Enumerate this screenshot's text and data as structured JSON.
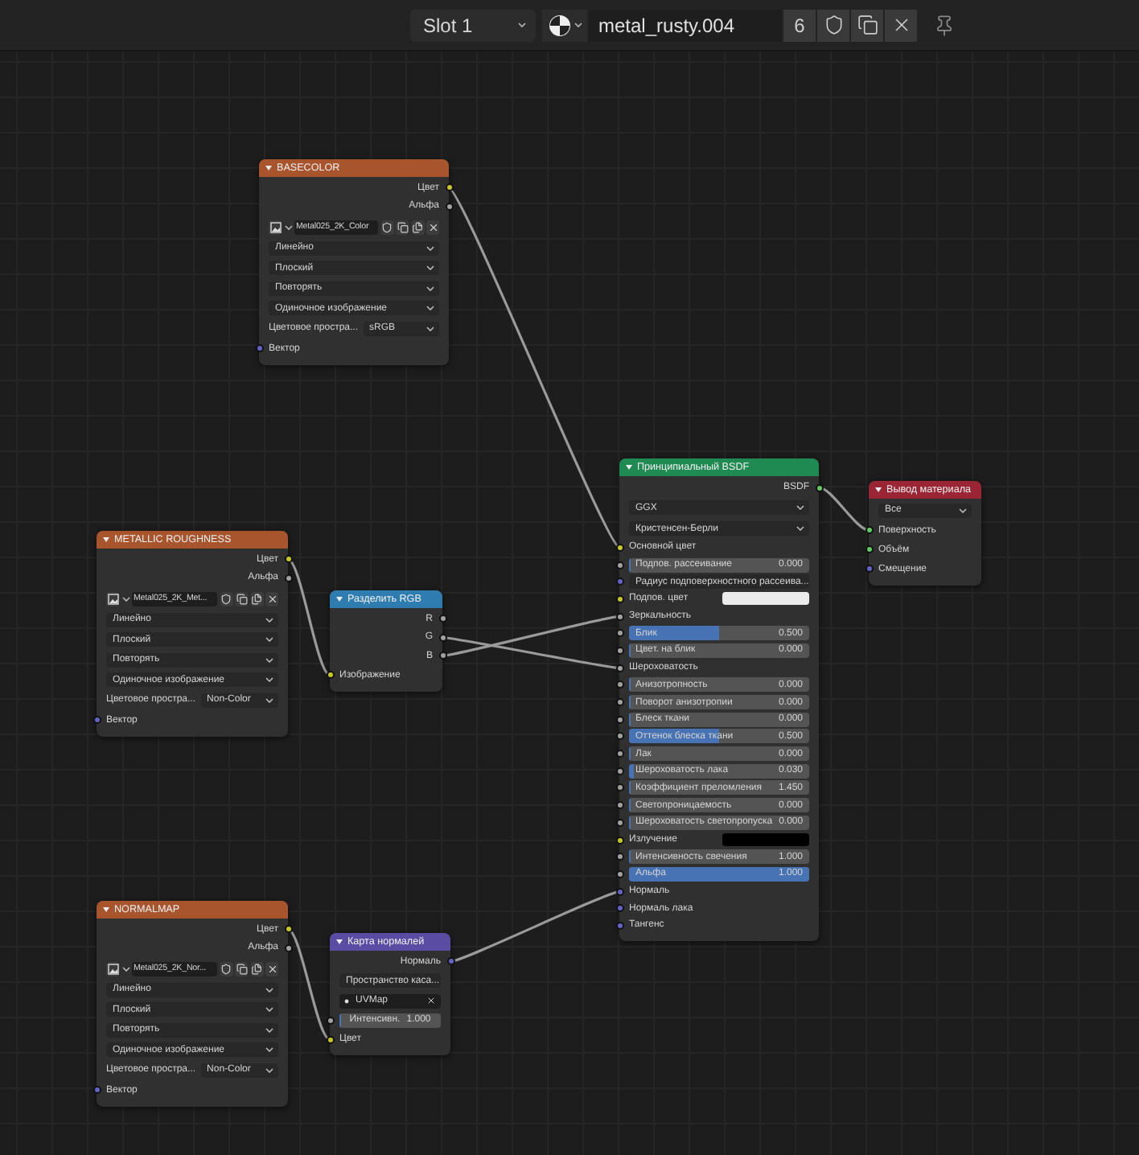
{
  "toolbar": {
    "slot": "Slot 1",
    "material_name": "metal_rusty.004",
    "users": "6"
  },
  "nodes": [
    {
      "kind": "image_texture",
      "title": "BASECOLOR",
      "color": "#a8552e",
      "rows": [
        {
          "kind": "output",
          "label": "Цвет",
          "color": "#c7c729"
        },
        {
          "kind": "output",
          "label": "Альфа",
          "color": "#a1a1a1"
        },
        {
          "kind": "image",
          "value": "Metal025_2K_Color"
        },
        {
          "kind": "dropdown",
          "value": "Линейно"
        },
        {
          "kind": "dropdown",
          "value": "Плоский"
        },
        {
          "kind": "dropdown",
          "value": "Повторять"
        },
        {
          "kind": "dropdown",
          "value": "Одиночное изображение"
        },
        {
          "kind": "prop",
          "label": "Цветовое простра...",
          "value": "sRGB"
        },
        {
          "kind": "input",
          "label": "Вектор",
          "color": "#6363c7"
        }
      ]
    },
    {
      "kind": "principled",
      "title": "Принципиальный BSDF",
      "color": "#1f8a52",
      "rows": [
        {
          "kind": "output",
          "label": "BSDF",
          "color": "#63c763"
        },
        {
          "kind": "dropdown",
          "value": "GGX"
        },
        {
          "kind": "dropdown",
          "value": "Кристенсен-Берли"
        },
        {
          "kind": "input",
          "label": "Основной цвет",
          "color": "#c7c729"
        },
        {
          "kind": "value",
          "label": "Подпов. рассеивание",
          "value": "0.000",
          "level": 0,
          "color": "#a1a1a1"
        },
        {
          "kind": "socket_menu",
          "value": "Радиус подповерхностного рассеива...",
          "color": "#6363c7"
        },
        {
          "kind": "color",
          "label": "Подпов. цвет",
          "swatch": {
            "color": "#ececec"
          },
          "color": "#c7c729"
        },
        {
          "kind": "input",
          "label": "Зеркальность",
          "color": "#a1a1a1"
        },
        {
          "kind": "value",
          "label": "Блик",
          "value": "0.500",
          "level": 0.5,
          "color": "#a1a1a1"
        },
        {
          "kind": "value",
          "label": "Цвет. на блик",
          "value": "0.000",
          "level": 0,
          "color": "#a1a1a1"
        },
        {
          "kind": "input",
          "label": "Шероховатость",
          "color": "#a1a1a1"
        },
        {
          "kind": "value",
          "label": "Анизотропность",
          "value": "0.000",
          "level": 0,
          "color": "#a1a1a1"
        },
        {
          "kind": "value",
          "label": "Поворот анизотропии",
          "value": "0.000",
          "level": 0,
          "color": "#a1a1a1"
        },
        {
          "kind": "value",
          "label": "Блеск ткани",
          "value": "0.000",
          "level": 0,
          "color": "#a1a1a1"
        },
        {
          "kind": "value",
          "label": "Оттенок блеска ткани",
          "value": "0.500",
          "level": 0.5,
          "color": "#a1a1a1"
        },
        {
          "kind": "value",
          "label": "Лак",
          "value": "0.000",
          "level": 0,
          "color": "#a1a1a1"
        },
        {
          "kind": "value",
          "label": "Шероховатость лака",
          "value": "0.030",
          "level": 0.03,
          "color": "#a1a1a1"
        },
        {
          "kind": "value",
          "label": "Коэффициент преломления",
          "value": "1.450",
          "level": 0,
          "color": "#a1a1a1"
        },
        {
          "kind": "value",
          "label": "Светопроницаемость",
          "value": "0.000",
          "level": 0,
          "color": "#a1a1a1"
        },
        {
          "kind": "value",
          "label": "Шероховатость светопропуска",
          "value": "0.000",
          "level": 0,
          "color": "#a1a1a1"
        },
        {
          "kind": "color",
          "label": "Излучение",
          "swatch": {
            "color": "#000000"
          },
          "color": "#c7c729"
        },
        {
          "kind": "value",
          "label": "Интенсивность свечения",
          "value": "1.000",
          "level": 0,
          "color": "#a1a1a1"
        },
        {
          "kind": "value",
          "label": "Альфа",
          "value": "1.000",
          "level": 1,
          "color": "#a1a1a1"
        },
        {
          "kind": "input",
          "label": "Нормаль",
          "color": "#6363c7"
        },
        {
          "kind": "input",
          "label": "Нормаль лака",
          "color": "#6363c7"
        },
        {
          "kind": "input",
          "label": "Тангенс",
          "color": "#6363c7"
        }
      ]
    },
    {
      "kind": "output_node",
      "title": "Вывод материала",
      "color": "#9a2535",
      "rows": [
        {
          "kind": "dropdown",
          "value": "Все"
        },
        {
          "kind": "input",
          "label": "Поверхность",
          "color": "#63c763"
        },
        {
          "kind": "input",
          "label": "Объём",
          "color": "#63c763"
        },
        {
          "kind": "input",
          "label": "Смещение",
          "color": "#6363c7"
        }
      ]
    },
    {
      "kind": "image_texture",
      "title": "METALLIC ROUGHNESS",
      "color": "#a8552e",
      "rows": [
        {
          "kind": "output",
          "label": "Цвет",
          "color": "#c7c729"
        },
        {
          "kind": "output",
          "label": "Альфа",
          "color": "#a1a1a1"
        },
        {
          "kind": "image",
          "value": "Metal025_2K_Met..."
        },
        {
          "kind": "dropdown",
          "value": "Линейно"
        },
        {
          "kind": "dropdown",
          "value": "Плоский"
        },
        {
          "kind": "dropdown",
          "value": "Повторять"
        },
        {
          "kind": "dropdown",
          "value": "Одиночное изображение"
        },
        {
          "kind": "prop",
          "label": "Цветовое простра...",
          "value": "Non-Color"
        },
        {
          "kind": "input",
          "label": "Вектор",
          "color": "#6363c7"
        }
      ]
    },
    {
      "kind": "separate_rgb",
      "title": "Разделить RGB",
      "color": "#2f7db0",
      "rows": [
        {
          "kind": "output",
          "label": "R",
          "color": "#a1a1a1"
        },
        {
          "kind": "output",
          "label": "G",
          "color": "#a1a1a1"
        },
        {
          "kind": "output",
          "label": "B",
          "color": "#a1a1a1"
        },
        {
          "kind": "input",
          "label": "Изображение",
          "color": "#c7c729"
        }
      ]
    },
    {
      "kind": "image_texture",
      "title": "NORMALMAP",
      "color": "#a8552e",
      "rows": [
        {
          "kind": "output",
          "label": "Цвет",
          "color": "#c7c729"
        },
        {
          "kind": "output",
          "label": "Альфа",
          "color": "#a1a1a1"
        },
        {
          "kind": "image",
          "value": "Metal025_2K_Nor..."
        },
        {
          "kind": "dropdown",
          "value": "Линейно"
        },
        {
          "kind": "dropdown",
          "value": "Плоский"
        },
        {
          "kind": "dropdown",
          "value": "Повторять"
        },
        {
          "kind": "dropdown",
          "value": "Одиночное изображение"
        },
        {
          "kind": "prop",
          "label": "Цветовое простра...",
          "value": "Non-Color"
        },
        {
          "kind": "input",
          "label": "Вектор",
          "color": "#6363c7"
        }
      ]
    },
    {
      "kind": "normal_map",
      "title": "Карта нормалей",
      "color": "#5b4ca3",
      "rows": [
        {
          "kind": "output",
          "label": "Нормаль",
          "color": "#6363c7"
        },
        {
          "kind": "dropdown",
          "value": "Пространство каса..."
        },
        {
          "kind": "uv",
          "value": "UVMap"
        },
        {
          "kind": "value",
          "label": "Интенсивн.",
          "value": "1.000",
          "level": 0,
          "color": "#a1a1a1"
        },
        {
          "kind": "input",
          "label": "Цвет",
          "color": "#c7c729"
        }
      ]
    }
  ]
}
